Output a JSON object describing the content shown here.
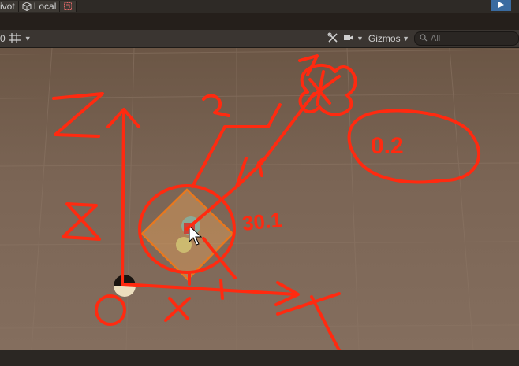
{
  "top_toolbar": {
    "pivot_label": "ivot",
    "local_label": "Local",
    "play_icon": "play-icon"
  },
  "scene_toolbar": {
    "left_value": "0",
    "grid_icon": "grid-snap-icon",
    "gizmos_label": "Gizmos",
    "search_placeholder": "All"
  },
  "annotations": {
    "axis_z": "Z",
    "axis_x": "X",
    "axis_x_small": "x",
    "origin": "0",
    "label_8": "8",
    "label_2": "2",
    "label_7": "7",
    "label_1": "1",
    "distance": "0.2",
    "angle": "30.1"
  },
  "colors": {
    "accent_play": "#3a6ba0",
    "annotation_red": "#ff2a10",
    "selection_orange": "#e8781e"
  }
}
